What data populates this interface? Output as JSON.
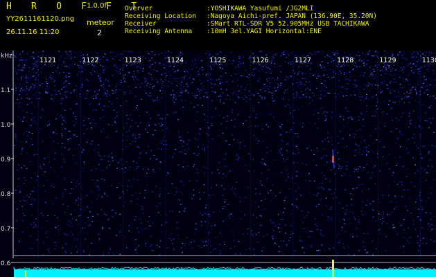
{
  "header": {
    "app_title": "H R O F F T",
    "version": "1.0.0f",
    "filename": "YY2611161120.png",
    "timestamp": "26.11.16 11:20",
    "meteor_label": "meteor",
    "meteor_count": "2"
  },
  "info": [
    {
      "label": "Overver",
      "value": ":YOSHIKAWA Yasufumi /JG2MLI"
    },
    {
      "label": "Receiving Location",
      "value": ":Nagoya Aichi-pref. JAPAN (136.90E, 35.20N)"
    },
    {
      "label": "Receiver",
      "value": ":SMart RTL-SDR V5 52.905MHz USB TACHIKAWA"
    },
    {
      "label": "Receiving Antenna",
      "value": ":10mH 3el.YAGI Horizontal:ENE"
    }
  ],
  "spectrogram": {
    "y_unit": "kHz",
    "y_ticks": [
      "1.1",
      "1.0",
      "0.9",
      "0.8",
      "0.7",
      "0.6"
    ],
    "time_ticks": [
      "1121",
      "1122",
      "1123",
      "1124",
      "1125",
      "1126",
      "1127",
      "1128",
      "1129",
      "1130"
    ],
    "colors": {
      "background": "#000010",
      "noise": "#1e34d8",
      "signal": "#ff3030",
      "trace": "#00f0ff",
      "marker": "#ffff00"
    }
  }
}
